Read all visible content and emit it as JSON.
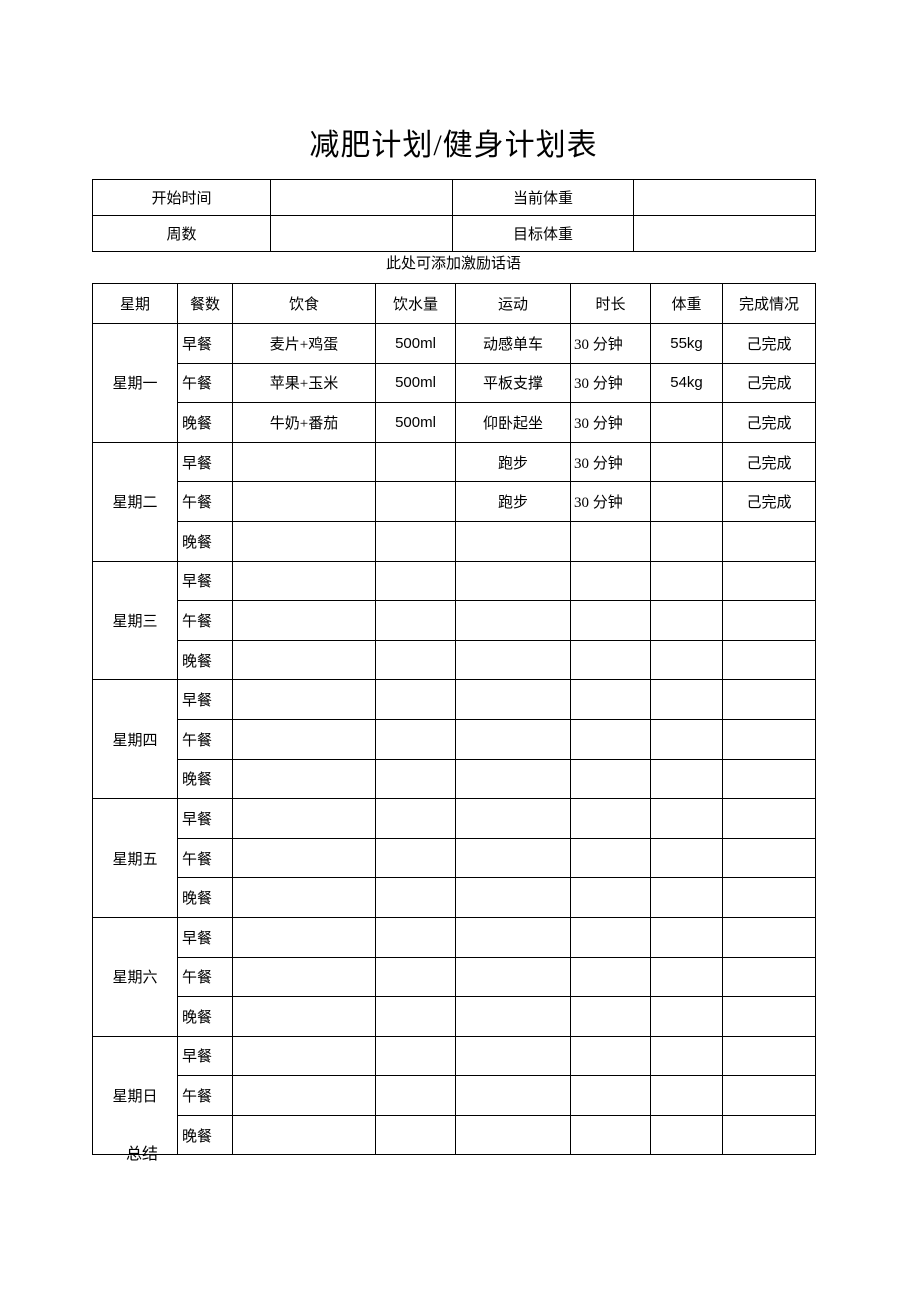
{
  "document": {
    "title": "减肥计划/健身计划表",
    "motivation_placeholder": "此处可添加激励话语",
    "summary_label": "总结"
  },
  "info_table": {
    "rows": [
      {
        "label_left": "开始时间",
        "value_left": "",
        "label_right": "当前体重",
        "value_right": ""
      },
      {
        "label_left": "周数",
        "value_left": "",
        "label_right": "目标体重",
        "value_right": ""
      }
    ]
  },
  "plan_table": {
    "headers": [
      "星期",
      "餐数",
      "饮食",
      "饮水量",
      "运动",
      "时长",
      "体重",
      "完成情况"
    ],
    "meals": [
      "早餐",
      "午餐",
      "晚餐"
    ],
    "days": [
      {
        "day": "星期一",
        "rows": [
          {
            "meal": "早餐",
            "diet": "麦片+鸡蛋",
            "water": "500ml",
            "exercise": "动感单车",
            "duration": "30 分钟",
            "weight": "55kg",
            "status": "己完成"
          },
          {
            "meal": "午餐",
            "diet": "苹果+玉米",
            "water": "500ml",
            "exercise": "平板支撑",
            "duration": "30 分钟",
            "weight": "54kg",
            "status": "己完成"
          },
          {
            "meal": "晚餐",
            "diet": "牛奶+番茄",
            "water": "500ml",
            "exercise": "仰卧起坐",
            "duration": "30 分钟",
            "weight": "",
            "status": "己完成"
          }
        ]
      },
      {
        "day": "星期二",
        "rows": [
          {
            "meal": "早餐",
            "diet": "",
            "water": "",
            "exercise": "跑步",
            "duration": "30 分钟",
            "weight": "",
            "status": "己完成"
          },
          {
            "meal": "午餐",
            "diet": "",
            "water": "",
            "exercise": "跑步",
            "duration": "30 分钟",
            "weight": "",
            "status": "己完成"
          },
          {
            "meal": "晚餐",
            "diet": "",
            "water": "",
            "exercise": "",
            "duration": "",
            "weight": "",
            "status": ""
          }
        ]
      },
      {
        "day": "星期三",
        "rows": [
          {
            "meal": "早餐",
            "diet": "",
            "water": "",
            "exercise": "",
            "duration": "",
            "weight": "",
            "status": ""
          },
          {
            "meal": "午餐",
            "diet": "",
            "water": "",
            "exercise": "",
            "duration": "",
            "weight": "",
            "status": ""
          },
          {
            "meal": "晚餐",
            "diet": "",
            "water": "",
            "exercise": "",
            "duration": "",
            "weight": "",
            "status": ""
          }
        ]
      },
      {
        "day": "星期四",
        "rows": [
          {
            "meal": "早餐",
            "diet": "",
            "water": "",
            "exercise": "",
            "duration": "",
            "weight": "",
            "status": ""
          },
          {
            "meal": "午餐",
            "diet": "",
            "water": "",
            "exercise": "",
            "duration": "",
            "weight": "",
            "status": ""
          },
          {
            "meal": "晚餐",
            "diet": "",
            "water": "",
            "exercise": "",
            "duration": "",
            "weight": "",
            "status": ""
          }
        ]
      },
      {
        "day": "星期五",
        "rows": [
          {
            "meal": "早餐",
            "diet": "",
            "water": "",
            "exercise": "",
            "duration": "",
            "weight": "",
            "status": ""
          },
          {
            "meal": "午餐",
            "diet": "",
            "water": "",
            "exercise": "",
            "duration": "",
            "weight": "",
            "status": ""
          },
          {
            "meal": "晚餐",
            "diet": "",
            "water": "",
            "exercise": "",
            "duration": "",
            "weight": "",
            "status": ""
          }
        ]
      },
      {
        "day": "星期六",
        "rows": [
          {
            "meal": "早餐",
            "diet": "",
            "water": "",
            "exercise": "",
            "duration": "",
            "weight": "",
            "status": ""
          },
          {
            "meal": "午餐",
            "diet": "",
            "water": "",
            "exercise": "",
            "duration": "",
            "weight": "",
            "status": ""
          },
          {
            "meal": "晚餐",
            "diet": "",
            "water": "",
            "exercise": "",
            "duration": "",
            "weight": "",
            "status": ""
          }
        ]
      },
      {
        "day": "星期日",
        "rows": [
          {
            "meal": "早餐",
            "diet": "",
            "water": "",
            "exercise": "",
            "duration": "",
            "weight": "",
            "status": ""
          },
          {
            "meal": "午餐",
            "diet": "",
            "water": "",
            "exercise": "",
            "duration": "",
            "weight": "",
            "status": ""
          },
          {
            "meal": "晚餐",
            "diet": "",
            "water": "",
            "exercise": "",
            "duration": "",
            "weight": "",
            "status": ""
          }
        ]
      }
    ]
  },
  "style": {
    "border_color": "#000000",
    "text_color": "#000000",
    "page_background": "#ffffff"
  }
}
